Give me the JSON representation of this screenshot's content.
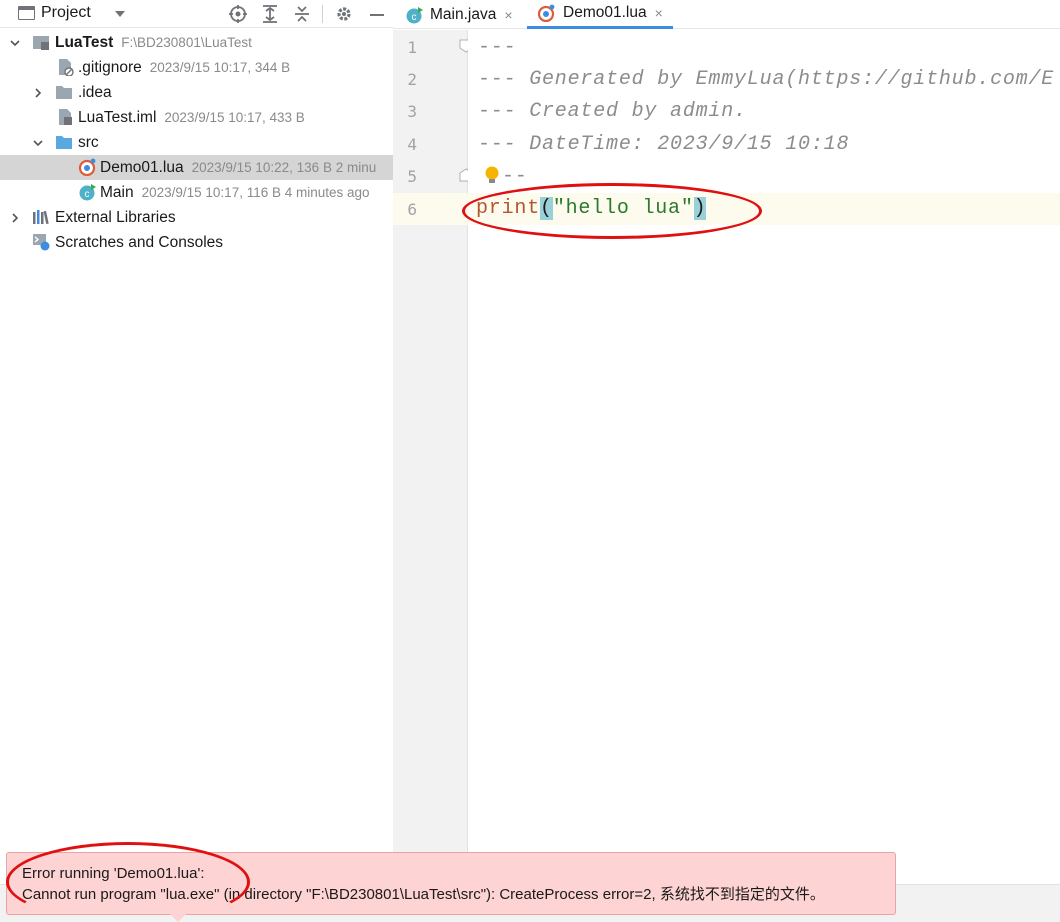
{
  "project_panel": {
    "title": "Project"
  },
  "tree": {
    "rows": [
      {
        "label": "LuaTest",
        "meta": "F:\\BD230801\\LuaTest"
      },
      {
        "label": ".gitignore",
        "meta": "2023/9/15 10:17, 344 B"
      },
      {
        "label": ".idea",
        "meta": ""
      },
      {
        "label": "LuaTest.iml",
        "meta": "2023/9/15 10:17, 433 B"
      },
      {
        "label": "src",
        "meta": ""
      },
      {
        "label": "Demo01.lua",
        "meta": "2023/9/15 10:22, 136 B 2 minu"
      },
      {
        "label": "Main",
        "meta": "2023/9/15 10:17, 116 B 4 minutes ago"
      },
      {
        "label": "External Libraries",
        "meta": ""
      },
      {
        "label": "Scratches and Consoles",
        "meta": ""
      }
    ]
  },
  "tabs": [
    {
      "label": "Main.java",
      "close": "×"
    },
    {
      "label": "Demo01.lua",
      "close": "×",
      "active": true
    }
  ],
  "editor": {
    "line_numbers": [
      "1",
      "2",
      "3",
      "4",
      "5",
      "6"
    ],
    "lines": {
      "l1": "---",
      "l2": "--- Generated by EmmyLua(https://github.com/E",
      "l3": "--- Created by admin.",
      "l4": "--- DateTime: 2023/9/15 10:18",
      "l5": "--",
      "l6_kw": "print",
      "l6_open": "(",
      "l6_str": "\"hello lua\"",
      "l6_close": ")"
    }
  },
  "error_popup": {
    "line1": "Error running 'Demo01.lua':",
    "line2": "Cannot run program \"lua.exe\" (in directory \"F:\\BD230801\\LuaTest\\src\"): CreateProcess error=2, 系统找不到指定的文件。"
  },
  "colors": {
    "selection": "#d5d5d5",
    "error_bg": "#fdd3d3",
    "annotation_ring": "#e01010",
    "tab_underline": "#3d8ce0"
  },
  "icons": [
    "window-icon",
    "locate-icon",
    "expand-all-icon",
    "collapse-all-icon",
    "gear-icon",
    "minimize-icon",
    "java-class-icon",
    "lua-file-icon",
    "folder-icon",
    "file-icon",
    "library-icon",
    "scratch-icon",
    "lightbulb-icon"
  ]
}
